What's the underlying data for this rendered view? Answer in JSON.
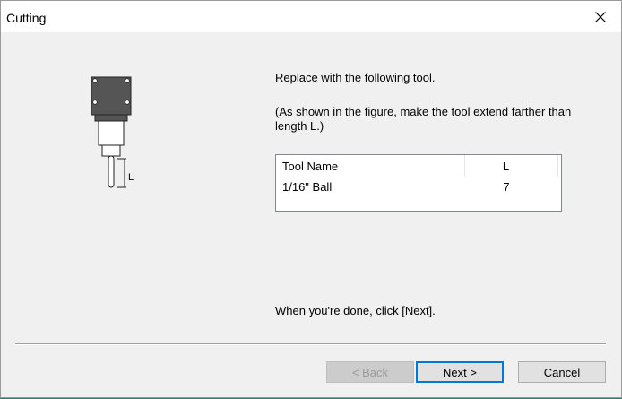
{
  "window": {
    "title": "Cutting"
  },
  "illustration": {
    "length_label": "L"
  },
  "instruction": "Replace with the following tool.",
  "note": "(As shown in the figure, make the tool extend farther than length L.)",
  "tool_table": {
    "columns": [
      "Tool Name",
      "L"
    ],
    "rows": [
      {
        "name": "1/16\" Ball",
        "length": "7"
      }
    ]
  },
  "done_message": "When you're done, click [Next].",
  "buttons": {
    "back": "< Back",
    "next": "Next >",
    "cancel": "Cancel"
  },
  "colors": {
    "focus_border": "#0078d7",
    "tool_body": "#555555"
  }
}
